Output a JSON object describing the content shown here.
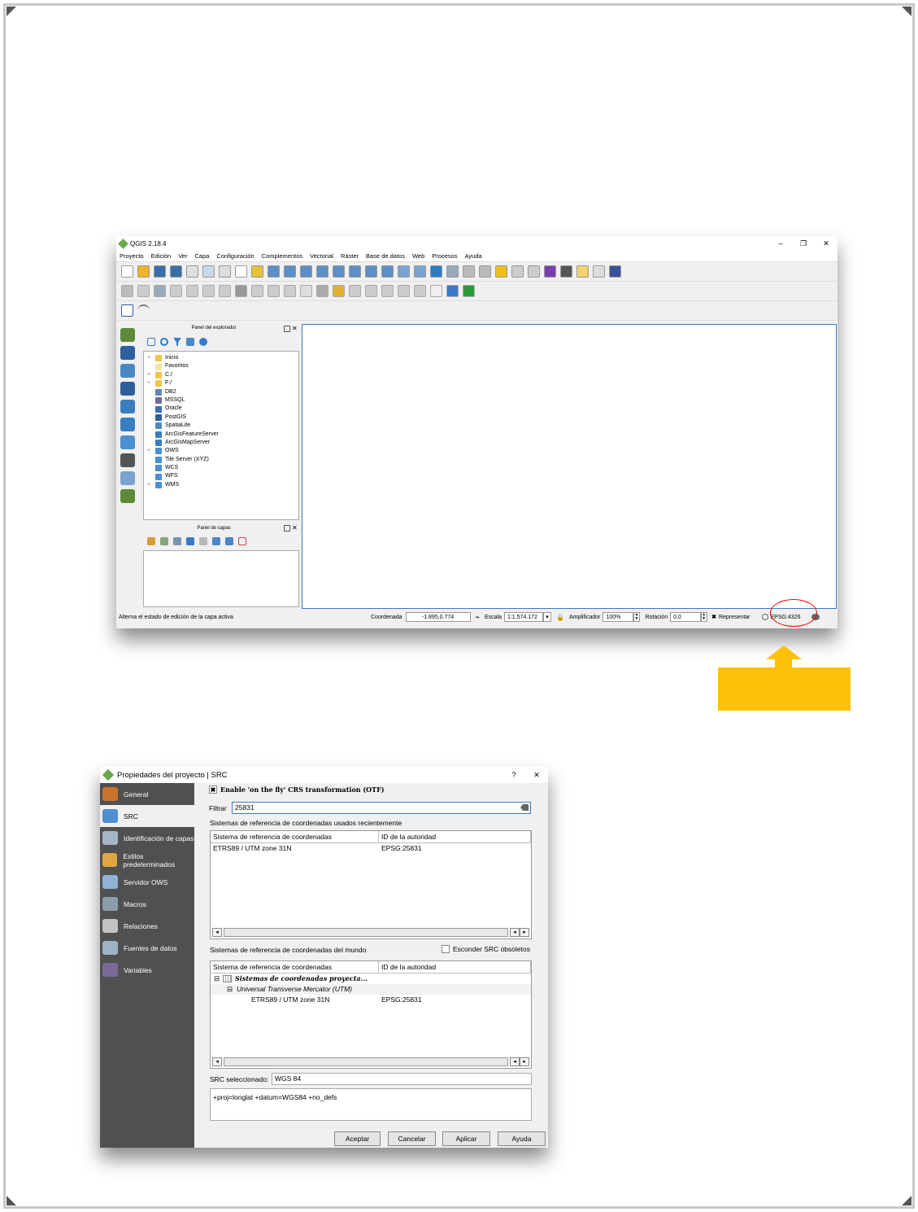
{
  "qgis": {
    "title": "QGIS 2.18.4",
    "menu": [
      "Proyecto",
      "Edición",
      "Ver",
      "Capa",
      "Configuración",
      "Complementos",
      "Vectorial",
      "Ráster",
      "Base de datos",
      "Web",
      "Procesos",
      "Ayuda"
    ],
    "window_controls": [
      "–",
      "❐",
      "✕"
    ],
    "browser_panel_title": "Panel del explorador",
    "layers_panel_title": "Panel de capas",
    "browser_items": [
      {
        "label": "Inicio",
        "expand": "+",
        "color": "#f3c44f"
      },
      {
        "label": "Favoritos",
        "expand": "",
        "color": "#f5e7a3"
      },
      {
        "label": "C:/",
        "expand": "+",
        "color": "#f3c44f"
      },
      {
        "label": "F:/",
        "expand": "+",
        "color": "#f3c44f"
      },
      {
        "label": "DB2",
        "expand": "",
        "color": "#5f86b8"
      },
      {
        "label": "MSSQL",
        "expand": "",
        "color": "#6b6b9c"
      },
      {
        "label": "Oracle",
        "expand": "",
        "color": "#3d6fb0"
      },
      {
        "label": "PostGIS",
        "expand": "",
        "color": "#2f5f9a"
      },
      {
        "label": "SpatiaLite",
        "expand": "",
        "color": "#4b88c0"
      },
      {
        "label": "ArcGisFeatureServer",
        "expand": "",
        "color": "#3a7dbf"
      },
      {
        "label": "ArcGisMapServer",
        "expand": "",
        "color": "#3a7dbf"
      },
      {
        "label": "OWS",
        "expand": "+",
        "color": "#4c90cf"
      },
      {
        "label": "Tile Server (XYZ)",
        "expand": "",
        "color": "#4c90cf"
      },
      {
        "label": "WCS",
        "expand": "",
        "color": "#4c90cf"
      },
      {
        "label": "WFS",
        "expand": "",
        "color": "#4c90cf"
      },
      {
        "label": "WMS",
        "expand": "+",
        "color": "#4c90cf"
      }
    ],
    "status": {
      "message": "Alterna el estado de edición de la capa activa",
      "coord_label": "Coordenada",
      "coord_value": "-1.895,0.774",
      "scale_label": "Escala",
      "scale_value": "1:1.574.172",
      "magnifier_label": "Amplificador",
      "magnifier_value": "100%",
      "rotation_label": "Rotación",
      "rotation_value": "0,0",
      "render_label": "Representar",
      "crs": "EPSG:4326"
    }
  },
  "dialog": {
    "title": "Propiedades del proyecto | SRC",
    "controls": [
      "?",
      "✕"
    ],
    "sidebar": [
      {
        "label": "General",
        "icon": "wrench-icon",
        "color": "#c9742b"
      },
      {
        "label": "SRC",
        "icon": "globe-icon",
        "color": "#4d8fd1"
      },
      {
        "label": "Identificación de capas",
        "icon": "identify-icon",
        "color": "#a7b6c6"
      },
      {
        "label": "Estilos predeterminados",
        "icon": "paintbrush-icon",
        "color": "#e0a642"
      },
      {
        "label": "Servidor OWS",
        "icon": "server-icon",
        "color": "#8fb3d6"
      },
      {
        "label": "Macros",
        "icon": "gear-icon",
        "color": "#8b9dab"
      },
      {
        "label": "Relaciones",
        "icon": "relations-icon",
        "color": "#c3c3c3"
      },
      {
        "label": "Fuentes de datos",
        "icon": "table-icon",
        "color": "#9eb3c4"
      },
      {
        "label": "Variables",
        "icon": "variables-icon",
        "color": "#7a6a9a"
      }
    ],
    "otf_label": "Enable 'on the fly' CRS transformation (OTF)",
    "filter_label": "Filtrar",
    "filter_value": "25831",
    "recent_label": "Sistemas de referencia de coordenadas usados recientemente",
    "col_crs": "Sistema de referencia de coordenadas",
    "col_authority": "ID de la autoridad",
    "recent_rows": [
      {
        "crs": "ETRS89 / UTM zone 31N",
        "auth": "EPSG:25831"
      }
    ],
    "world_label": "Sistemas de referencia de coordenadas del mundo",
    "hide_obsolete_label": "Esconder SRC obsoletos",
    "world_tree": {
      "group": "Sistemas de coordenadas proyecta...",
      "subgroup": "Universal Transverse Mercator (UTM)",
      "leaf_crs": "ETRS89 / UTM zone 31N",
      "leaf_auth": "EPSG:25831"
    },
    "selected_label": "SRC seleccionado:",
    "selected_value": "WGS 84",
    "proj_string": "+proj=longlat +datum=WGS84 +no_defs",
    "buttons": {
      "ok": "Aceptar",
      "cancel": "Cancelar",
      "apply": "Aplicar",
      "help": "Ayuda"
    }
  },
  "colors": {
    "accent_arrow": "#ffc107",
    "highlight_ring": "#ee0000",
    "map_border": "#3c78c8",
    "dialog_sidebar": "#505050"
  }
}
